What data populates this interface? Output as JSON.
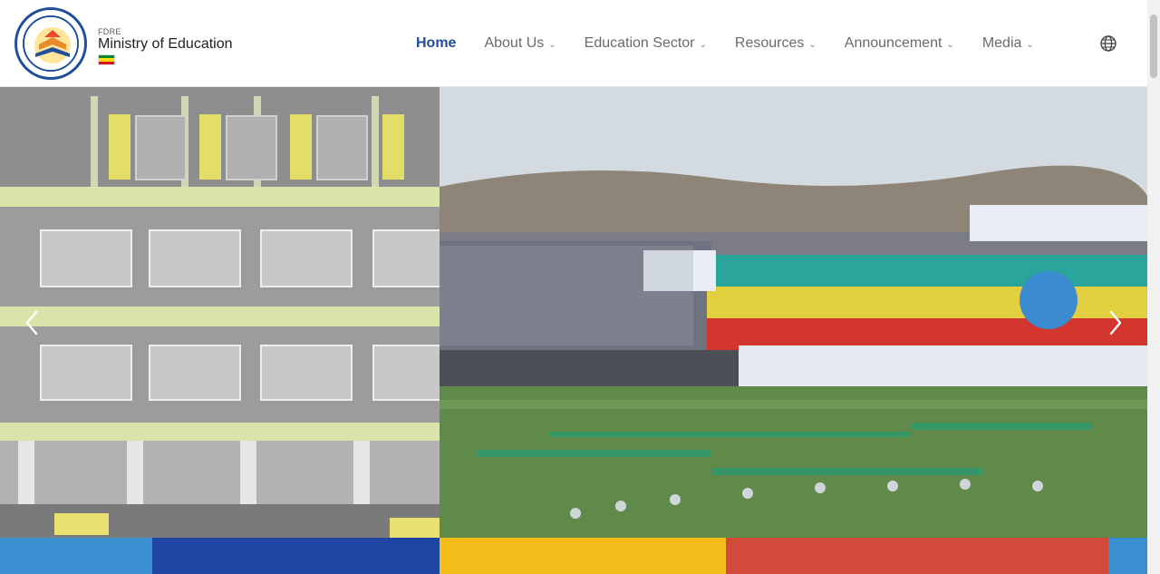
{
  "brand": {
    "prefix": "FDRE",
    "name": "Ministry of Education",
    "logo_ring_text": "MINISTRY OF EDUCATION",
    "flag_colors": [
      "#078930",
      "#fcdd09",
      "#da121a"
    ]
  },
  "nav": {
    "items": [
      {
        "label": "Home",
        "active": true,
        "has_dropdown": false
      },
      {
        "label": "About Us",
        "active": false,
        "has_dropdown": true
      },
      {
        "label": "Education Sector",
        "active": false,
        "has_dropdown": true
      },
      {
        "label": "Resources",
        "active": false,
        "has_dropdown": true
      },
      {
        "label": "Announcement",
        "active": false,
        "has_dropdown": true
      },
      {
        "label": "Media",
        "active": false,
        "has_dropdown": true
      }
    ],
    "dropdown_icon": "chevron-down-icon",
    "language_icon": "globe-icon"
  },
  "hero": {
    "left_slide": "school-building-photo",
    "right_slide": "stadium-celebration-photo",
    "prev_icon": "chevron-left-icon",
    "next_icon": "chevron-right-icon"
  },
  "colors": {
    "primary": "#1f4f9a",
    "strip": [
      "#3a8fd0",
      "#1f45a3",
      "#f5bd1b",
      "#d24b3a",
      "#3a8fd0"
    ]
  }
}
